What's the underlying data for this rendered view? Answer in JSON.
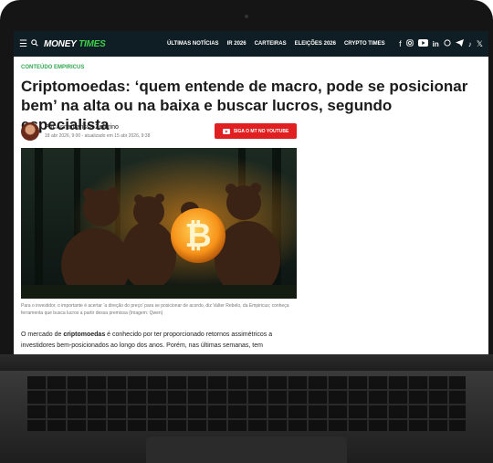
{
  "nav": {
    "logo_a": "MONEY",
    "logo_b": "TIMES",
    "menu": [
      "ÚLTIMAS NOTÍCIAS",
      "IR 2026",
      "CARTEIRAS",
      "ELEIÇÕES 2026",
      "CRYPTO TIMES"
    ],
    "social_icons": [
      "facebook-icon",
      "instagram-icon",
      "youtube-icon",
      "linkedin-icon",
      "whatsapp-icon",
      "telegram-icon",
      "tiktok-icon",
      "x-icon"
    ]
  },
  "article": {
    "tag": "CONTEÚDO EMPIRICUS",
    "title": "Criptomoedas: ‘quem entende de macro, pode se posicionar bem’ na alta ou na baixa e buscar lucros, segundo especialista",
    "byline": "Por Anna Larissa Zeferino",
    "dates": "18 abr 2026, 9:00 - atualizado em 15 abr 2026, 9:38",
    "youtube_button": "SIGA O MT NO YOUTUBE",
    "caption": "Para o investidor, o importante é acertar ‘a direção do preço’ para se posicionar de acordo, diz Valter Rebelo, da Empiricus; conheça ferramenta que busca lucros a partir dessa premissa (Imagem: Qwen)",
    "body_pre": "O mercado de ",
    "body_bold": "criptomoedas",
    "body_post": " é conhecido por ter proporcionado retornos assimétricos a investidores bem-posicionados ao longo dos anos. Porém, nas últimas semanas, tem"
  },
  "colors": {
    "nav_bg": "#0f1d24",
    "brand_green": "#3ecf4a",
    "tag_green": "#2fa84f",
    "youtube_red": "#e02020",
    "bitcoin_orange": "#f7931a"
  }
}
